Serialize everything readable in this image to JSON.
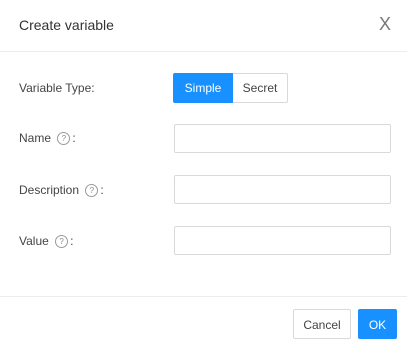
{
  "dialog": {
    "title": "Create variable",
    "close_glyph": "X"
  },
  "form": {
    "variable_type": {
      "label": "Variable Type",
      "suffix": ":",
      "options": [
        "Simple",
        "Secret"
      ],
      "selected": "Simple"
    },
    "name": {
      "label": "Name",
      "help_glyph": "?",
      "suffix": ":",
      "value": "",
      "placeholder": ""
    },
    "description": {
      "label": "Description",
      "help_glyph": "?",
      "suffix": ":",
      "value": "",
      "placeholder": ""
    },
    "value": {
      "label": "Value",
      "help_glyph": "?",
      "suffix": ":",
      "value": "",
      "placeholder": ""
    }
  },
  "footer": {
    "cancel_label": "Cancel",
    "ok_label": "OK"
  },
  "colors": {
    "primary": "#1890ff",
    "border": "#d9d9d9",
    "divider": "#ececec"
  }
}
